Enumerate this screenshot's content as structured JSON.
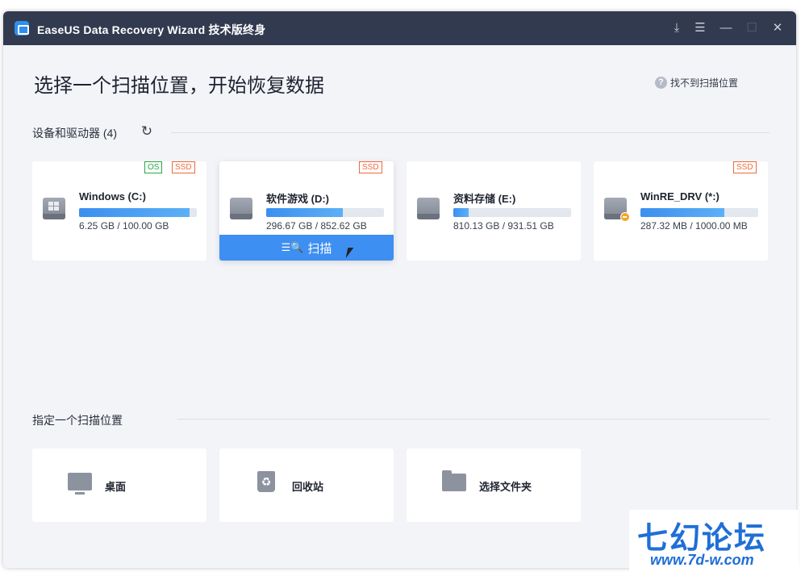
{
  "titlebar": {
    "app_title": "EaseUS Data Recovery Wizard  技术版终身",
    "controls": [
      "download-icon",
      "menu-icon",
      "minimize-icon",
      "maximize-icon",
      "close-icon"
    ]
  },
  "main": {
    "heading": "选择一个扫描位置，开始恢复数据",
    "help_link": "找不到扫描位置",
    "devices_section_title": "设备和驱动器 (4)",
    "drives": [
      {
        "name": "Windows (C:)",
        "size": "6.25 GB / 100.00 GB",
        "used_fraction": 0.94,
        "badges": [
          "OS",
          "SSD"
        ],
        "icon": "windows-drive-icon"
      },
      {
        "name": "软件游戏 (D:)",
        "size": "296.67 GB / 852.62 GB",
        "used_fraction": 0.65,
        "badges": [
          "SSD"
        ],
        "icon": "drive-icon",
        "action_label": "扫描"
      },
      {
        "name": "资料存储 (E:)",
        "size": "810.13 GB / 931.51 GB",
        "used_fraction": 0.13,
        "badges": [],
        "icon": "drive-icon"
      },
      {
        "name": "WinRE_DRV (*:)",
        "size": "287.32 MB / 1000.00 MB",
        "used_fraction": 0.71,
        "badges": [
          "SSD"
        ],
        "icon": "drive-warning-icon"
      }
    ],
    "locations_section_title": "指定一个扫描位置",
    "locations": [
      {
        "label": "桌面",
        "icon": "desktop-icon"
      },
      {
        "label": "回收站",
        "icon": "recycle-bin-icon"
      },
      {
        "label": "选择文件夹",
        "icon": "folder-icon"
      }
    ]
  },
  "watermark": {
    "title": "七幻论坛",
    "url": "www.7d-w.com"
  },
  "colors": {
    "titlebar": "#323a4f",
    "accent": "#3d8ff2",
    "os_badge": "#27a844",
    "ssd_badge": "#ef6a3c"
  }
}
